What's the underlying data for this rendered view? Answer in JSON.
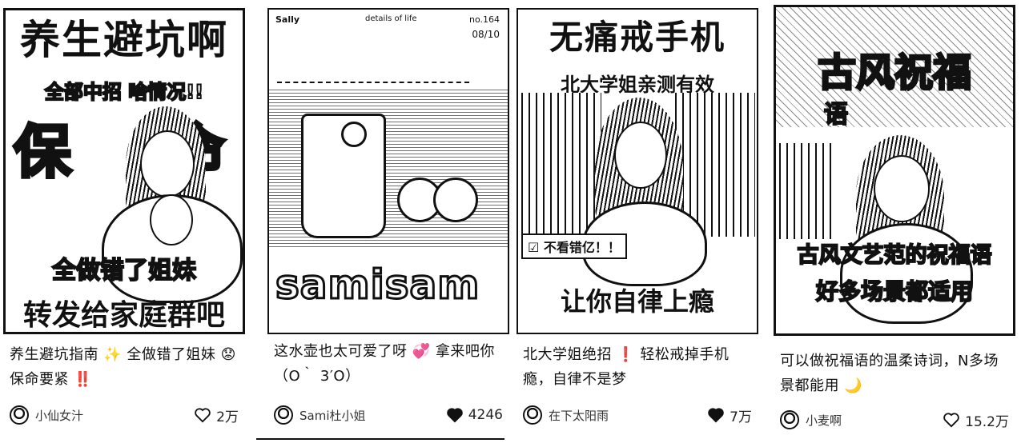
{
  "cards": [
    {
      "image": {
        "title": "养生避坑啊",
        "subtitle": "全部中招 啥情况!!",
        "big": "保命",
        "line1": "全做错了姐妹",
        "line2": "转发给家庭群吧"
      },
      "caption": "养生避坑指南 ✨ 全做错了姐妹 😟 保命要紧 ‼️",
      "author": "小仙女汁",
      "likes": "2万",
      "liked": false
    },
    {
      "image": {
        "masthead": "Sally",
        "tagline": "details of life",
        "issue": "no.164",
        "date": "08/10",
        "brand": "samisam"
      },
      "caption": "这水壶也太可爱了呀 💞 拿来吧你（O｀ 3′O）",
      "author": "Sami杜小姐",
      "likes": "4246",
      "liked": true
    },
    {
      "image": {
        "title": "无痛戒手机",
        "subtitle": "北大学姐亲测有效",
        "badge": "☑ 不看错亿！！",
        "bottom": "让你自律上瘾"
      },
      "caption": "北大学姐绝招 ❗ 轻松戒掉手机瘾，自律不是梦",
      "author": "在下太阳雨",
      "likes": "7万",
      "liked": true
    },
    {
      "image": {
        "title": "古风祝福",
        "sub": "语",
        "line1": "古风文艺范的祝福语",
        "line2": "好多场景都适用"
      },
      "caption": "可以做祝福语的温柔诗词，N多场景都能用 🌙",
      "author": "小麦啊",
      "likes": "15.2万",
      "liked": false
    }
  ]
}
